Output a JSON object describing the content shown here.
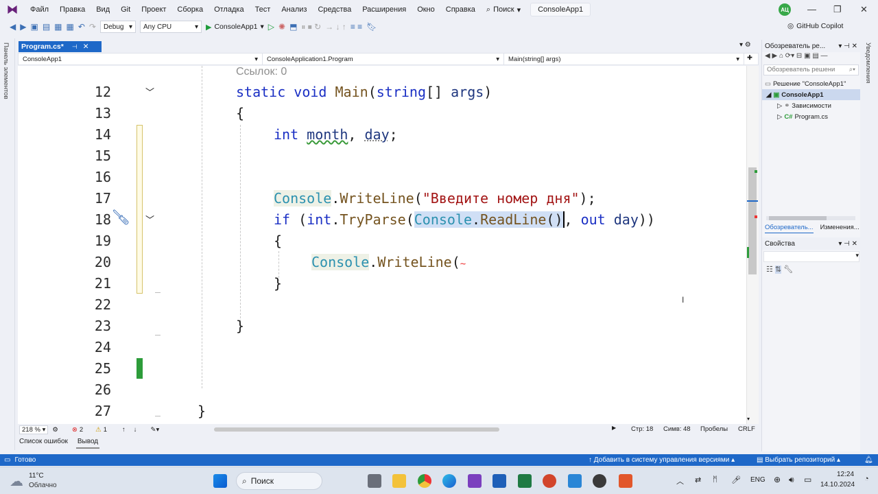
{
  "menu": {
    "items": [
      "Файл",
      "Правка",
      "Вид",
      "Git",
      "Проект",
      "Сборка",
      "Отладка",
      "Тест",
      "Анализ",
      "Средства",
      "Расширения",
      "Окно",
      "Справка"
    ],
    "search_label": "Поиск",
    "solution_name": "ConsoleApp1",
    "avatar": "АЦ"
  },
  "toolbar": {
    "config": "Debug",
    "platform": "Any CPU",
    "run_target": "ConsoleApp1",
    "copilot": "GitHub Copilot"
  },
  "left_strip_label": "Панель элементов",
  "right_strip_label": "Уведомления",
  "tab": {
    "label": "Program.cs*"
  },
  "navbar": {
    "project": "ConsoleApp1",
    "class": "ConsoleApplication1.Program",
    "member": "Main(string[] args)"
  },
  "editor": {
    "codelens": "Ссылок: 0",
    "line_numbers": [
      "12",
      "13",
      "14",
      "15",
      "16",
      "17",
      "18",
      "19",
      "20",
      "21",
      "22",
      "23",
      "24",
      "25",
      "26",
      "27"
    ],
    "lines": {
      "l12": [
        "static",
        " ",
        "void",
        " ",
        "Main",
        "(",
        "string",
        "[] ",
        "args",
        ")"
      ],
      "l13": "{",
      "l14": [
        "int",
        " ",
        "month",
        ", ",
        "day",
        ";"
      ],
      "l17": [
        "Console",
        ".",
        "WriteLine",
        "(",
        "\"Введите номер дня\"",
        ");"
      ],
      "l18": [
        "if",
        " (",
        "int",
        ".",
        "TryParse",
        "(",
        "Console",
        ".",
        "ReadLine",
        "()",
        ", ",
        "out",
        " ",
        "day",
        "))"
      ],
      "l19": "{",
      "l20": [
        "Console",
        ".",
        "WriteLine",
        "("
      ],
      "l21": "}",
      "l23": "}",
      "l27": "}"
    }
  },
  "editor_status": {
    "zoom": "218 %",
    "errors": "2",
    "warnings": "1",
    "line": "Стр: 18",
    "col": "Симв: 48",
    "spaces": "Пробелы",
    "eol": "CRLF"
  },
  "bottom_tabs": [
    "Список ошибок",
    "Вывод"
  ],
  "solution_explorer": {
    "title": "Обозреватель ре...",
    "search_placeholder": "Обозреватель решени",
    "items": [
      "Решение \"ConsoleApp1\"",
      "ConsoleApp1",
      "Зависимости",
      "Program.cs"
    ],
    "tabs": [
      "Обозреватель...",
      "Изменения..."
    ]
  },
  "properties": {
    "title": "Свойства"
  },
  "status": {
    "ready": "Готово",
    "add_source_control": "Добавить в систему управления версиями",
    "select_repo": "Выбрать репозиторий"
  },
  "taskbar": {
    "temp": "11°C",
    "weather": "Облачно",
    "search": "Поиск",
    "lang": "ENG",
    "time": "12:24",
    "date": "14.10.2024"
  },
  "colors": {
    "accent": "#1e68c8",
    "keyword": "#1a2fc4",
    "type": "#2b91af",
    "method": "#74531f",
    "string": "#a31515"
  }
}
